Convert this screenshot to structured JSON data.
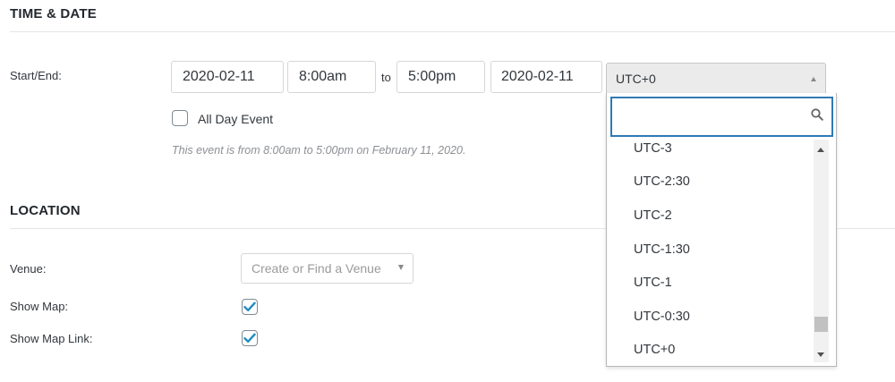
{
  "time_date": {
    "section_title": "TIME & DATE",
    "start_end_label": "Start/End:",
    "start_date": "2020-02-11",
    "start_time": "8:00am",
    "to_label": "to",
    "end_time": "5:00pm",
    "end_date": "2020-02-11",
    "timezone_selected": "UTC+0",
    "all_day_label": "All Day Event",
    "all_day_checked": false,
    "description": "This event is from 8:00am to 5:00pm on February 11, 2020."
  },
  "timezone_dropdown": {
    "search_value": "",
    "options": [
      "UTC-3",
      "UTC-2:30",
      "UTC-2",
      "UTC-1:30",
      "UTC-1",
      "UTC-0:30",
      "UTC+0"
    ],
    "scroll_position_fraction": 0.97
  },
  "location": {
    "section_title": "LOCATION",
    "venue_label": "Venue:",
    "venue_placeholder": "Create or Find a Venue",
    "show_map_label": "Show Map:",
    "show_map_checked": true,
    "show_map_link_label": "Show Map Link:",
    "show_map_link_checked": true
  },
  "colors": {
    "focus_blue": "#2f79b5",
    "check_blue": "#1e8cbe"
  }
}
